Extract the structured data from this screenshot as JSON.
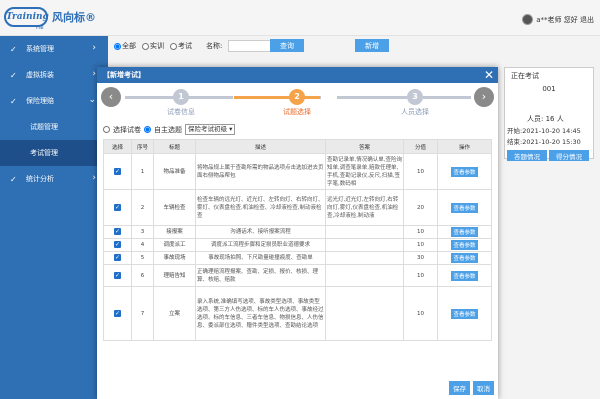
{
  "header": {
    "logo_text": "Training",
    "logo_sub": "FSB",
    "brand": "风向标®",
    "user_text": "a**老师 您好 退出"
  },
  "sidebar": {
    "items": [
      {
        "label": "系统管理",
        "expanded": false
      },
      {
        "label": "虚拟拆装",
        "expanded": false
      },
      {
        "label": "保险理赔",
        "expanded": true
      },
      {
        "label": "试题管理",
        "sub": true,
        "active": false
      },
      {
        "label": "考试管理",
        "sub": true,
        "active": true
      },
      {
        "label": "统计分析",
        "expanded": false
      }
    ]
  },
  "filter": {
    "options": [
      "全部",
      "实训",
      "考试"
    ],
    "selected": "全部",
    "name_label": "名称:",
    "name_value": "",
    "query_btn": "查询",
    "add_btn": "新增"
  },
  "exam_panel": {
    "title": "正在考试",
    "exam_no": "001",
    "people": "人员: 16 人",
    "start": "开始:2021-10-20 14:45",
    "end": "结束:2021-10-20 15:30",
    "btn_answer": "答题情况",
    "btn_score": "得分情况"
  },
  "modal": {
    "title": "【新增考试】",
    "steps": [
      {
        "num": "1",
        "label": "试卷信息"
      },
      {
        "num": "2",
        "label": "试题选择"
      },
      {
        "num": "3",
        "label": "人员选择"
      }
    ],
    "active_step": 2,
    "accent": "#f5a34a",
    "inactive": "#c2c7d4",
    "qtype": {
      "opt1": "选择试卷",
      "opt2": "自主选题",
      "selected": "自主选题",
      "select_value": "保险考试初级"
    },
    "columns": [
      "选择",
      "序号",
      "标题",
      "描述",
      "答案",
      "分值",
      "操作"
    ],
    "rows": [
      {
        "checked": true,
        "no": "1",
        "title": "物品准备",
        "desc": "将物品规上属于查勘所需的物品选项点击选加进去页面右侧物品帮包",
        "ans": "查勘记录单,情况确认单,查险询知单,调查笔录单,赔款任理单,手机,查勘记录仪,反尺,扫描,签字笔,数码相",
        "score": "10",
        "op": "查看参数"
      },
      {
        "checked": true,
        "no": "2",
        "title": "车辆检查",
        "desc": "检查车辆的远光灯、近光灯、左转向灯、右转向灯、雾灯、仪表盘检查,机油检查、冷却液检查,制动液检查",
        "ans": "远光灯,近光灯,左转向灯,右转向灯,雾灯,仪表盘检查,机油检查,冷却液检,制动液",
        "score": "20",
        "op": "查看参数"
      },
      {
        "checked": true,
        "no": "3",
        "title": "接报案",
        "desc": "沟通话术、接听报案流程",
        "ans": "",
        "score": "10",
        "op": "查看参数"
      },
      {
        "checked": true,
        "no": "4",
        "title": "调度派工",
        "desc": "调度派工流程步骤和定损员职业道德要求",
        "ans": "",
        "score": "10",
        "op": "查看参数"
      },
      {
        "checked": true,
        "no": "5",
        "title": "事故现场",
        "desc": "事故现场拍照、下尺勘量碰撞痕度、查勘单",
        "ans": "",
        "score": "30",
        "op": "查看参数"
      },
      {
        "checked": true,
        "no": "6",
        "title": "理赔告知",
        "desc": "正确理赔流程报案、查勘、定损、报价、核损、理算、核赔、赔款",
        "ans": "",
        "score": "10",
        "op": "查看参数"
      },
      {
        "checked": true,
        "no": "7",
        "title": "立案",
        "desc": "录入系统,准确填写选项、事故类型选项、事故类型选项、第三方人伤选项、标的车人伤选项、事故经过选项、标的车信息、三者车信息、物损信息、人伤信息、委派部位选项、赠件类型选项、查勘结论选项",
        "ans": "",
        "score": "10",
        "op": "查看参数"
      }
    ],
    "save_btn": "保存",
    "cancel_btn": "取消"
  }
}
